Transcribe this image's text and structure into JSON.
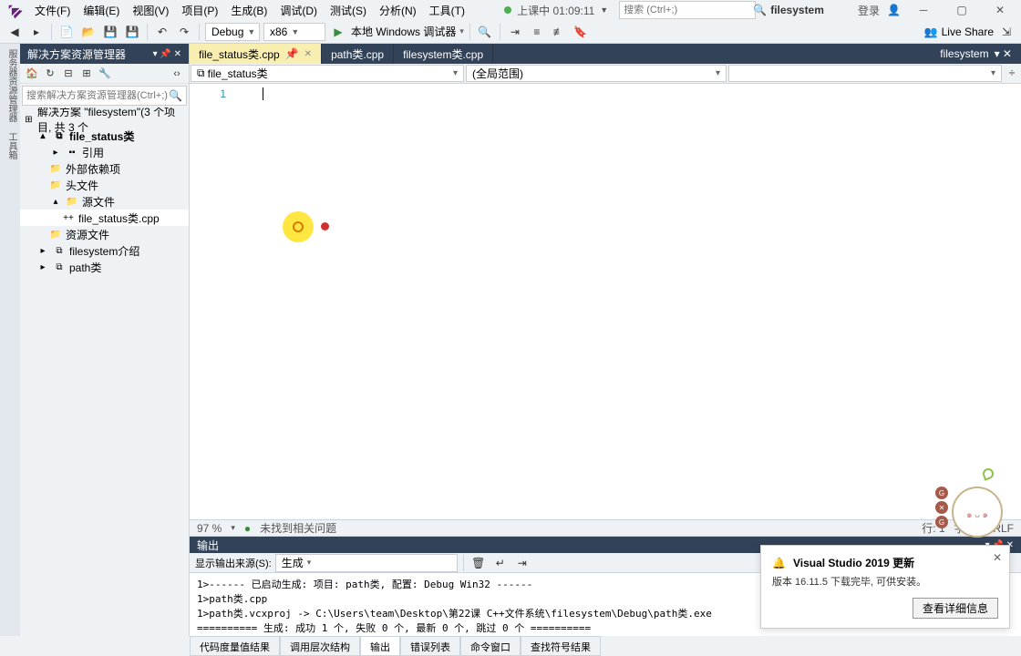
{
  "menu": [
    "文件(F)",
    "编辑(E)",
    "视图(V)",
    "项目(P)",
    "生成(B)",
    "调试(D)",
    "测试(S)",
    "分析(N)",
    "工具(T)"
  ],
  "recording": {
    "label": "上课中 01:09:11"
  },
  "topSearch": {
    "placeholder": "搜索 (Ctrl+;)"
  },
  "appTitle": "filesystem",
  "login": "登录",
  "toolbar": {
    "config": "Debug",
    "platform": "x86",
    "run": "本地 Windows 调试器",
    "liveshare": "Live Share"
  },
  "explorer": {
    "title": "解决方案资源管理器",
    "searchPlaceholder": "搜索解决方案资源管理器(Ctrl+;)",
    "root": "解决方案 \"filesystem\"(3 个项目, 共 3 个",
    "nodes": {
      "proj1": "file_status类",
      "ref": "引用",
      "ext": "外部依赖项",
      "hdr": "头文件",
      "src": "源文件",
      "srcfile": "file_status类.cpp",
      "res": "资源文件",
      "proj2": "filesystem介绍",
      "proj3": "path类"
    }
  },
  "tabs": {
    "t1": "file_status类.cpp",
    "t2": "path类.cpp",
    "t3": "filesystem类.cpp",
    "right": "filesystem"
  },
  "nav": {
    "left": "file_status类",
    "right": "(全局范围)"
  },
  "editor": {
    "lineNum": "1"
  },
  "statusbar": {
    "zoom": "97 %",
    "issue": "未找到相关问题",
    "line": "行: 1",
    "col": "字符",
    "crlf": "CRLF"
  },
  "output": {
    "title": "输出",
    "srcLabel": "显示输出来源(S):",
    "src": "生成",
    "lines": [
      "1>------ 已启动生成: 项目: path类, 配置: Debug Win32 ------",
      "1>path类.cpp",
      "1>path类.vcxproj -> C:\\Users\\team\\Desktop\\第22课 C++文件系统\\filesystem\\Debug\\path类.exe",
      "========== 生成: 成功 1 个, 失败 0 个, 最新 0 个, 跳过 0 个 =========="
    ]
  },
  "bottomTabs": [
    "代码度量值结果",
    "调用层次结构",
    "输出",
    "错误列表",
    "命令窗口",
    "查找符号结果"
  ],
  "notif": {
    "title": "Visual Studio 2019 更新",
    "body": "版本 16.11.5 下载完毕, 可供安装。",
    "btn": "查看详细信息"
  }
}
